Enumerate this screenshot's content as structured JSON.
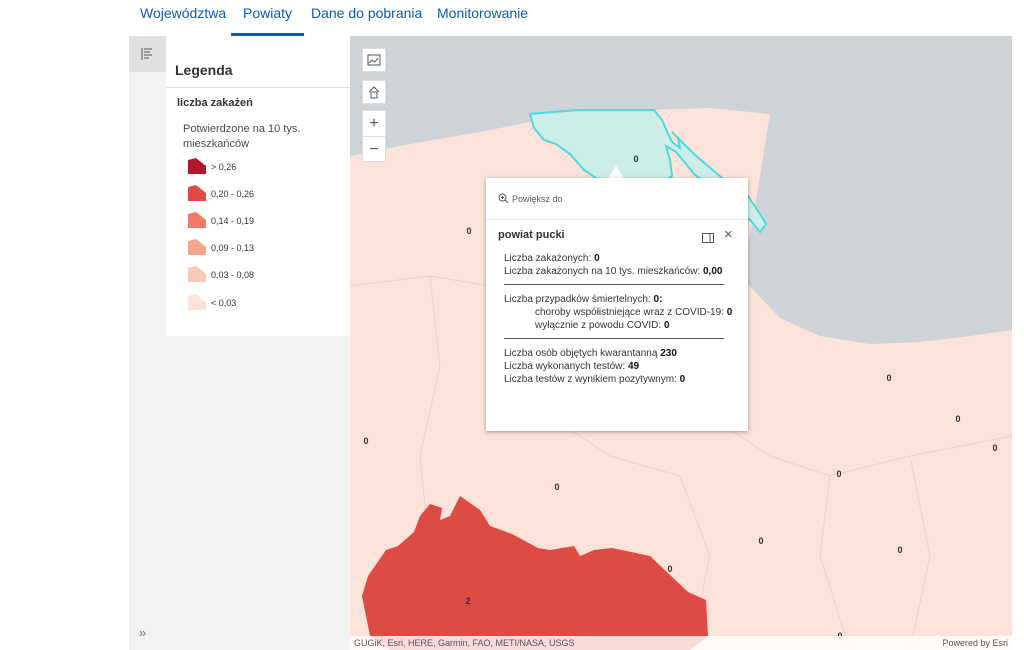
{
  "nav": {
    "tabs": [
      {
        "label": "Województwa",
        "active": false
      },
      {
        "label": "Powiaty",
        "active": true
      },
      {
        "label": "Dane do pobrania",
        "active": false
      },
      {
        "label": "Monitorowanie",
        "active": false
      }
    ]
  },
  "rail": {
    "expand_label": "»"
  },
  "legend": {
    "title": "Legenda",
    "layer_title": "liczba zakażeń",
    "field_label": "Potwierdzone na 10 tys. mieszkańców",
    "classes": [
      {
        "label": "> 0,26",
        "color": "#b2182b"
      },
      {
        "label": "0,20 - 0,26",
        "color": "#de4b45"
      },
      {
        "label": "0,14 - 0,19",
        "color": "#f07a64"
      },
      {
        "label": "0,09 - 0,13",
        "color": "#f6a68d"
      },
      {
        "label": "0,03 - 0,08",
        "color": "#f9c9b8"
      },
      {
        "label": "< 0,03",
        "color": "#fbe3da"
      }
    ]
  },
  "map": {
    "labels": {
      "pucki": "0",
      "l1": "0",
      "l2": "0",
      "l3": "0",
      "l4": "0",
      "l5": "0",
      "l6": "0",
      "l7": "0",
      "l8": "0",
      "l9": "0",
      "l10": "0",
      "l11": "0",
      "red": "2"
    },
    "attribution_left": "GUGiK, Esri, HERE, Garmin, FAO, METI/NASA, USGS",
    "attribution_right": "Powered by Esri",
    "colors": {
      "sea": "#cdd3d6",
      "land": "#fbe3da",
      "highlight": "#cdeee8",
      "highlight_stroke": "#4dd9e0",
      "red": "#de4b45"
    }
  },
  "popup": {
    "zoom_label": "Powiększ do",
    "title": "powiat pucki",
    "l1_label": "Liczba zakażonych: ",
    "l1_value": "0",
    "l2_label": "Liczba zakażonych na 10 tys. mieszkańców: ",
    "l2_value": "0,00",
    "l3_label": "Liczba przypadków śmiertelnych: ",
    "l3_value": "0:",
    "l4_label": "choroby współistniejące wraz z COVID-19: ",
    "l4_value": "0",
    "l5_label": "wyłącznie z powodu COVID: ",
    "l5_value": "0",
    "l6_label": "Liczba osób objętych kwarantanną ",
    "l6_value": "230",
    "l7_label": "Liczba wykonanych testów: ",
    "l7_value": "49",
    "l8_label": "Liczba testów z wynikiem pozytywnym: ",
    "l8_value": "0"
  }
}
